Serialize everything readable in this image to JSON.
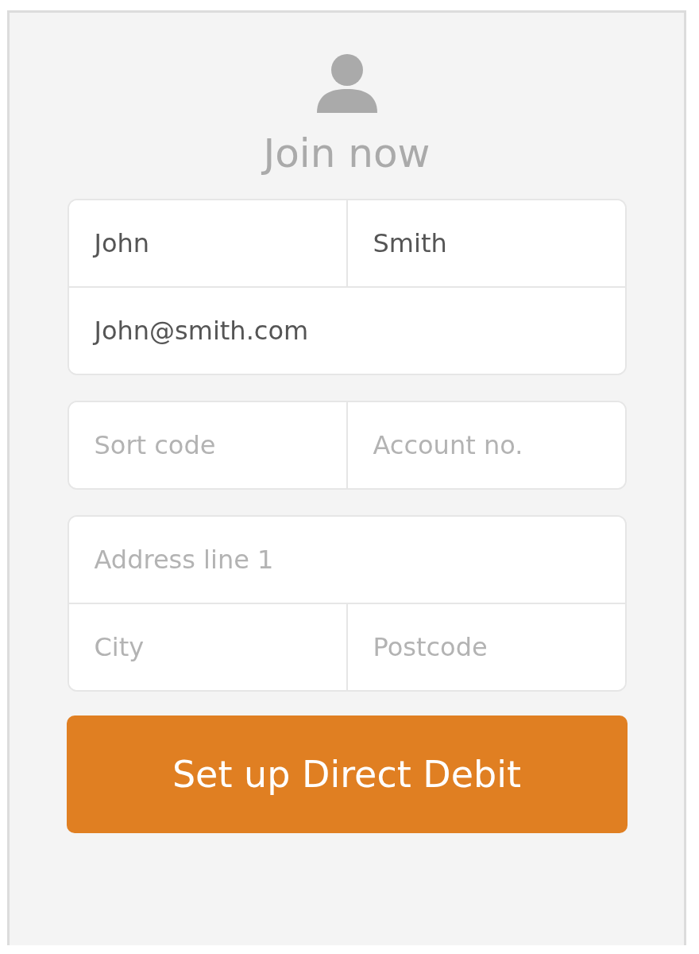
{
  "title": "Join now",
  "groups": [
    {
      "rows": [
        [
          {
            "value": "John"
          },
          {
            "value": "Smith"
          }
        ],
        [
          {
            "value": "John@smith.com"
          }
        ]
      ]
    },
    {
      "rows": [
        [
          {
            "placeholder": "Sort code"
          },
          {
            "placeholder": "Account no."
          }
        ]
      ]
    },
    {
      "rows": [
        [
          {
            "placeholder": "Address line 1"
          }
        ],
        [
          {
            "placeholder": "City"
          },
          {
            "placeholder": "Postcode"
          }
        ]
      ]
    }
  ],
  "button": "Set up Direct Debit"
}
